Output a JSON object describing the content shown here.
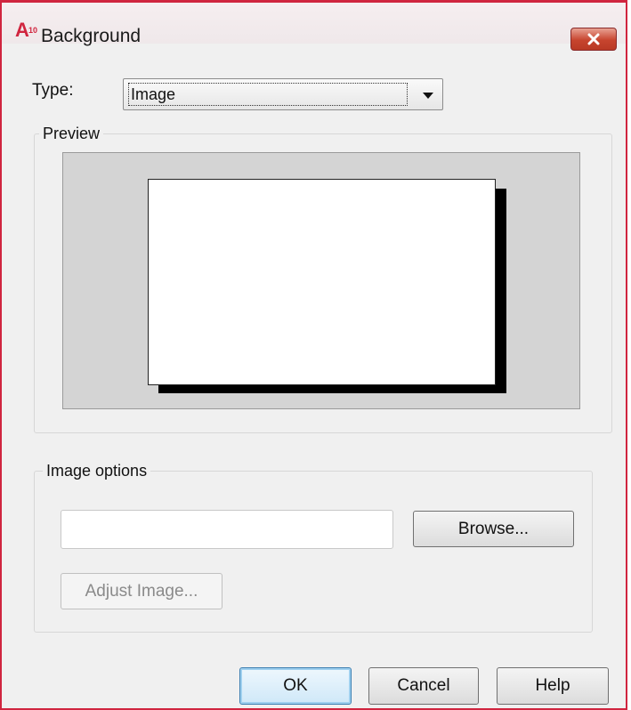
{
  "window": {
    "title": "Background",
    "app_icon": {
      "letter": "A",
      "version": "10"
    },
    "accent_color": "#d0253f"
  },
  "type_row": {
    "label": "Type:",
    "selected": "Image"
  },
  "preview": {
    "group_label": "Preview"
  },
  "image_options": {
    "group_label": "Image options",
    "path_value": "",
    "browse_label": "Browse...",
    "adjust_label": "Adjust Image..."
  },
  "footer": {
    "ok_label": "OK",
    "cancel_label": "Cancel",
    "help_label": "Help"
  }
}
